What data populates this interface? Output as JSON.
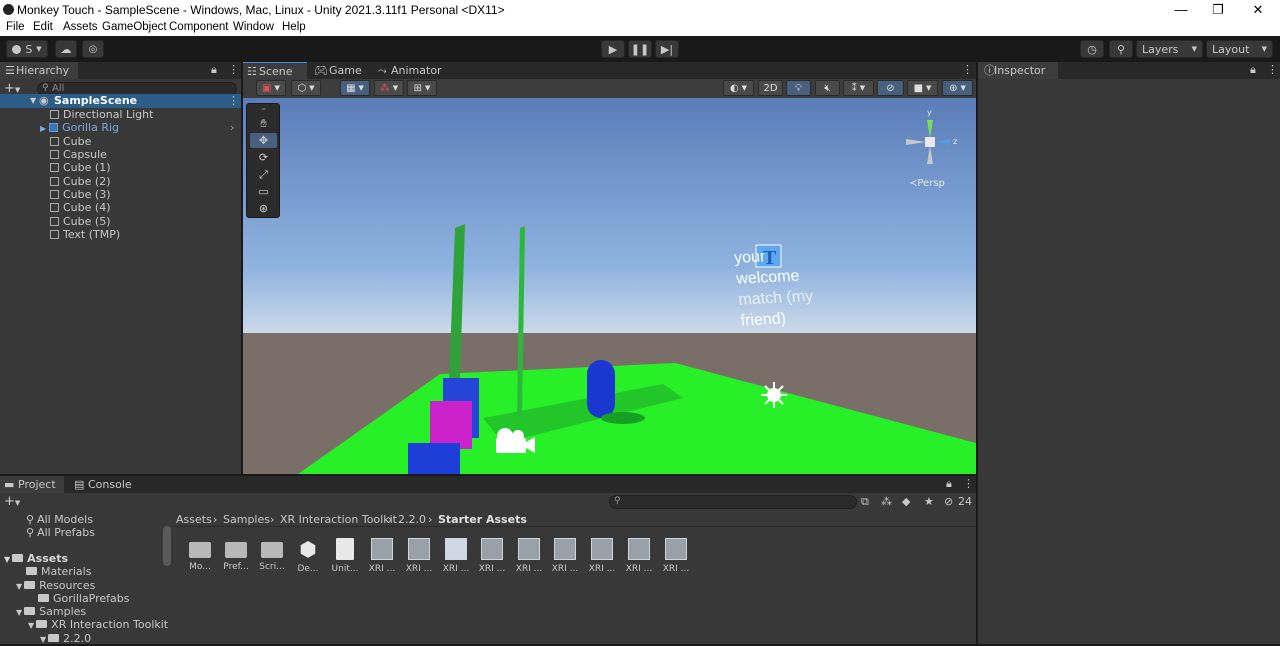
{
  "window": {
    "title": "Monkey Touch - SampleScene - Windows, Mac, Linux - Unity 2021.3.11f1 Personal <DX11>",
    "minimize": "—",
    "maximize": "❐",
    "close": "✕"
  },
  "menu": [
    "File",
    "Edit",
    "Assets",
    "GameObject",
    "Component",
    "Window",
    "Help"
  ],
  "toolbar": {
    "account_label": "S",
    "layers_label": "Layers",
    "layout_label": "Layout"
  },
  "hierarchy": {
    "tab_label": "Hierarchy",
    "search_placeholder": "All",
    "scene_name": "SampleScene",
    "items": [
      "Directional Light",
      "Gorilla Rig",
      "Cube",
      "Capsule",
      "Cube (1)",
      "Cube (2)",
      "Cube (3)",
      "Cube (4)",
      "Cube (5)",
      "Text (TMP)"
    ]
  },
  "scene_tabs": [
    "Scene",
    "Game",
    "Animator"
  ],
  "scene_toolbar": {
    "mode_2d": "2D"
  },
  "gizmo": {
    "y": "y",
    "z": "z",
    "persp": "≺Persp"
  },
  "scene_text": {
    "line1": "your",
    "line2": "welcome",
    "line3": "match (my",
    "line4": "friend)"
  },
  "inspector": {
    "tab_label": "Inspector"
  },
  "project": {
    "tabs": [
      "Project",
      "Console"
    ],
    "hidden_count": "24",
    "breadcrumb": [
      "Assets",
      "Samples",
      "XR Interaction Toolkit",
      "2.2.0",
      "Starter Assets"
    ],
    "favorites": [
      "All Models",
      "All Prefabs"
    ],
    "tree": {
      "root": "Assets",
      "children": [
        "Materials",
        "Resources",
        "GorillaPrefabs",
        "Samples",
        "XR Interaction Toolkit",
        "2.2.0"
      ]
    },
    "assets": [
      "Mo...",
      "Pref...",
      "Scri...",
      "De...",
      "Unit...",
      "XRI ...",
      "XRI ...",
      "XRI ...",
      "XRI ...",
      "XRI ...",
      "XRI ...",
      "XRI ...",
      "XRI ...",
      "XRI ..."
    ]
  }
}
